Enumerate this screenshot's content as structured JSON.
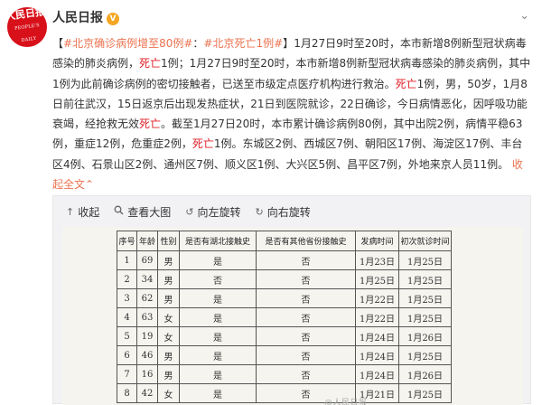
{
  "header": {
    "avatar_text": "人民日报",
    "avatar_sub": "PEOPLE'S DAILY",
    "account_name": "人民日报",
    "verified_icon": "verified-badge-icon",
    "menu_icon": "chevron-down-icon"
  },
  "post": {
    "tag1": "#北京确诊病例增至80例#",
    "tag_sep": "：",
    "tag2": "#北京死亡1例#",
    "bracket_open": "【",
    "bracket_close": "】",
    "p1": "1月27日9时至20时，本市新增8例新型冠状病毒感染的肺炎病例，",
    "death1": "死亡",
    "p2": "1例；1月27日9时至20时，本市新增8例新型冠状病毒感染的肺炎病例，其中1例为此前确诊病例的密切接触者，已送至市级定点医疗机构进行救治。",
    "death2": "死亡",
    "p3": "1例，男，50岁，1月8日前往武汉，15日返京后出现发热症状，21日到医院就诊，22日确诊，今日病情恶化，因呼吸功能衰竭，经抢救无效",
    "death3": "死亡",
    "p4": "。截至1月27日20时，本市累计确诊病例80例，其中出院2例，病情平稳63例，重症12例，危重症2例，",
    "death4": "死亡",
    "p5": "1例。东城区2例、西城区7例、朝阳区17例、海淀区17例、丰台区4例、石景山区2例、通州区7例、顺义区1例、大兴区5例、昌平区7例，外地来京人员11例。",
    "collapse_label": "收起全文",
    "collapse_icon": "chevron-up-icon"
  },
  "media": {
    "toolbar": [
      {
        "icon": "arrow-up-icon",
        "label": "收起"
      },
      {
        "icon": "search-icon",
        "label": "查看大图"
      },
      {
        "icon": "rotate-left-icon",
        "label": "向左旋转"
      },
      {
        "icon": "rotate-right-icon",
        "label": "向右旋转"
      }
    ],
    "watermark": "@人民日报",
    "table": {
      "headers": [
        "序号",
        "年龄",
        "性别",
        "是否有湖北接触史",
        "是否有其他省份接触史",
        "发病时间",
        "初次就诊时间"
      ],
      "rows": [
        [
          "1",
          "69",
          "男",
          "是",
          "否",
          "1月23日",
          "1月25日"
        ],
        [
          "2",
          "34",
          "男",
          "否",
          "否",
          "1月25日",
          "1月25日"
        ],
        [
          "3",
          "62",
          "男",
          "是",
          "否",
          "1月22日",
          "1月25日"
        ],
        [
          "4",
          "63",
          "女",
          "是",
          "否",
          "1月22日",
          "1月25日"
        ],
        [
          "5",
          "19",
          "女",
          "是",
          "否",
          "1月24日",
          "1月26日"
        ],
        [
          "6",
          "46",
          "男",
          "是",
          "否",
          "1月24日",
          "1月25日"
        ],
        [
          "7",
          "16",
          "男",
          "是",
          "否",
          "1月24日",
          "1月26日"
        ],
        [
          "8",
          "42",
          "女",
          "是",
          "否",
          "1月21日",
          "1月25日"
        ]
      ]
    }
  }
}
